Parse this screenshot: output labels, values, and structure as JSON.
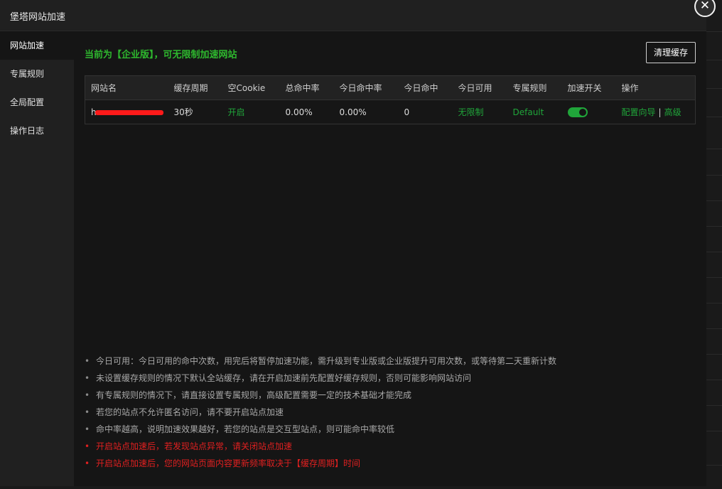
{
  "window": {
    "title": "堡塔网站加速"
  },
  "sidebar": {
    "items": [
      {
        "label": "网站加速",
        "active": true
      },
      {
        "label": "专属规则"
      },
      {
        "label": "全局配置"
      },
      {
        "label": "操作日志"
      }
    ]
  },
  "main": {
    "notice": "当前为【企业版】，可无限制加速网站",
    "clear_cache_label": "清理缓存"
  },
  "table": {
    "headers": [
      "网站名",
      "缓存周期",
      "空Cookie",
      "总命中率",
      "今日命中率",
      "今日命中",
      "今日可用",
      "专属规则",
      "加速开关",
      "操作"
    ],
    "rows": [
      {
        "site_prefix": "h",
        "cache_period": "30秒",
        "empty_cookie": "开启",
        "total_hit_rate": "0.00%",
        "today_hit_rate": "0.00%",
        "today_hits": "0",
        "today_available": "无限制",
        "rule": "Default",
        "enabled": true,
        "action_config": "配置向导",
        "action_sep": "|",
        "action_advanced": "高级"
      }
    ]
  },
  "tips": [
    {
      "text": "今日可用：今日可用的命中次数，用完后将暂停加速功能，需升级到专业版或企业版提升可用次数，或等待第二天重新计数"
    },
    {
      "text": "未设置缓存规则的情况下默认全站缓存，请在开启加速前先配置好缓存规则，否则可能影响网站访问"
    },
    {
      "text": "有专属规则的情况下，请直接设置专属规则，高级配置需要一定的技术基础才能完成"
    },
    {
      "text": "若您的站点不允许匿名访问，请不要开启站点加速"
    },
    {
      "text": "命中率越高，说明加速效果越好，若您的站点是交互型站点，则可能命中率较低"
    },
    {
      "text": "开启站点加速后，若发现站点异常，请关闭站点加速",
      "warning": true
    },
    {
      "text": "开启站点加速后，您的网站页面内容更新频率取决于【缓存周期】时间",
      "warning": true
    }
  ],
  "colors": {
    "accent": "#20a53a",
    "warning": "#e02020",
    "redaction": "#ff1a1a"
  }
}
